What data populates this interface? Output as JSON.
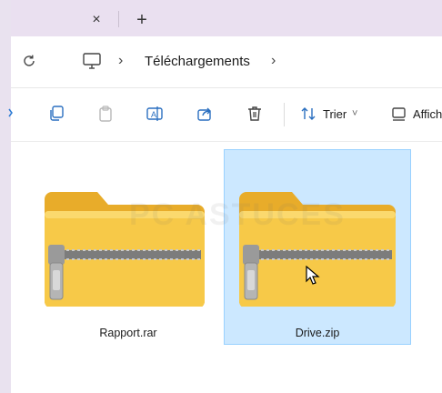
{
  "window": {
    "tab_close_glyph": "×",
    "tab_add_glyph": "+"
  },
  "addressbar": {
    "refresh_icon": "refresh-icon",
    "location_icon": "this-pc-icon",
    "separator": "›",
    "breadcrumb_current": "Téléchargements"
  },
  "toolbar": {
    "sort_label": "Trier",
    "view_label": "Affich",
    "sort_chevron": "˅"
  },
  "files": [
    {
      "name": "Rapport.rar",
      "type": "compressed-folder-icon",
      "selected": false
    },
    {
      "name": "Drive.zip",
      "type": "compressed-folder-icon",
      "selected": true
    }
  ],
  "watermark": "PC ASTUCES",
  "colors": {
    "tabbar_bg": "#eae0f0",
    "selection_bg": "#cce8ff",
    "selection_border": "#99d1ff",
    "folder_yellow": "#f7c948",
    "folder_dark": "#e8ac2a",
    "zipper": "#8a8a8a"
  }
}
